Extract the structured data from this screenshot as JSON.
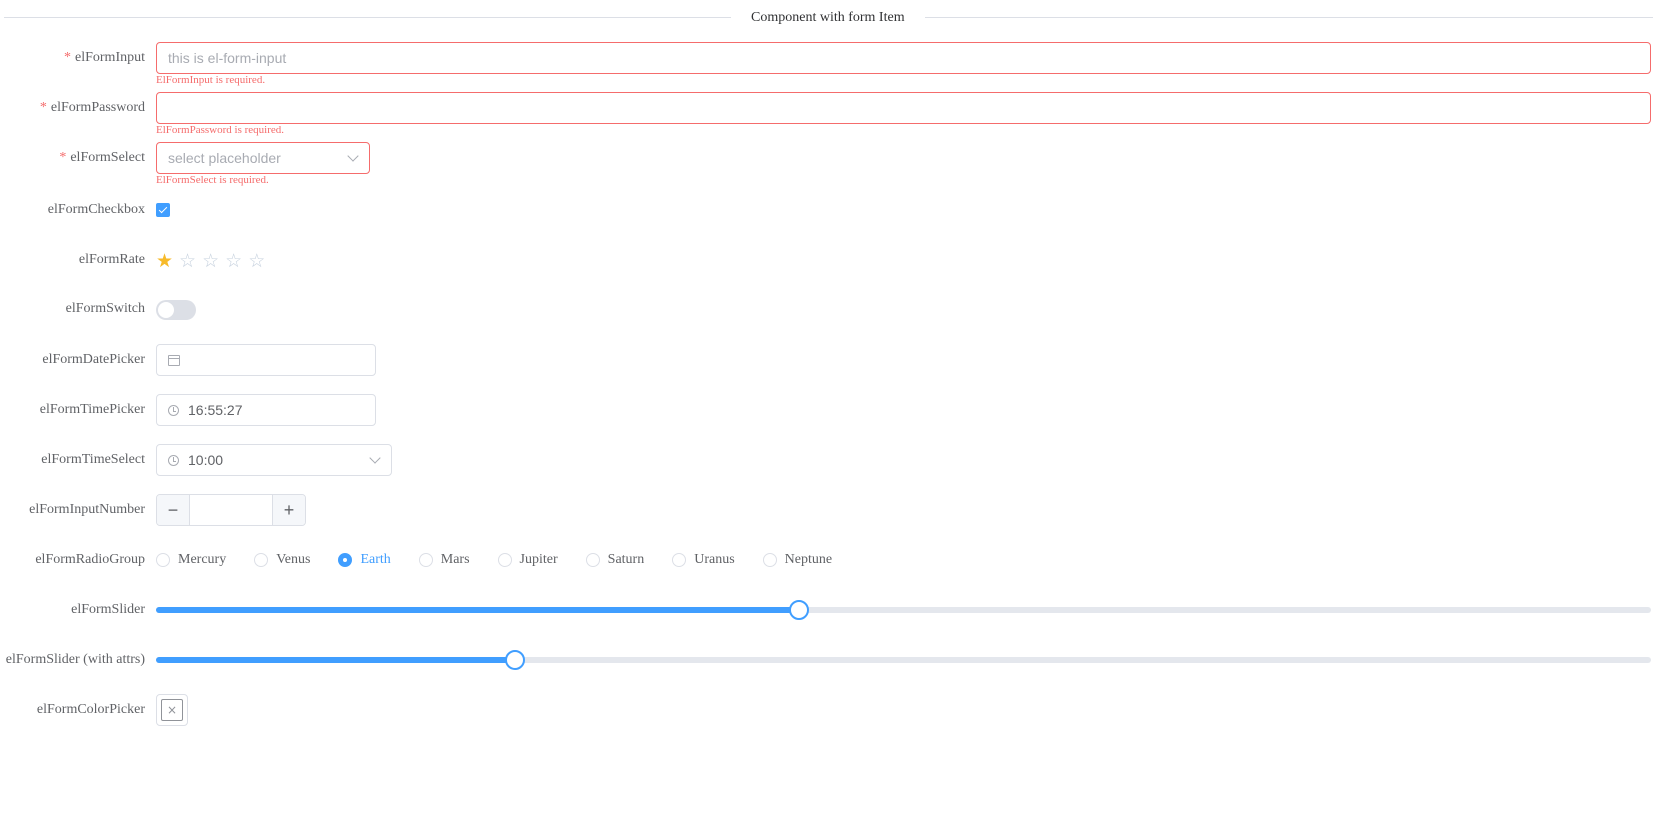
{
  "divider": {
    "text": "Component with form Item"
  },
  "fields": {
    "input": {
      "label": "elFormInput",
      "required": "*",
      "placeholder": "this is el-form-input",
      "error": "ElFormInput is required."
    },
    "password": {
      "label": "elFormPassword",
      "required": "*",
      "error": "ElFormPassword is required."
    },
    "select": {
      "label": "elFormSelect",
      "required": "*",
      "placeholder": "select placeholder",
      "error": "ElFormSelect is required."
    },
    "checkbox": {
      "label": "elFormCheckbox",
      "checked": true
    },
    "rate": {
      "label": "elFormRate",
      "value": 1,
      "max": 5,
      "active_color": "#f7ba2a"
    },
    "switch": {
      "label": "elFormSwitch",
      "on": false
    },
    "datepicker": {
      "label": "elFormDatePicker",
      "value": ""
    },
    "timepicker": {
      "label": "elFormTimePicker",
      "value": "16:55:27"
    },
    "timeselect": {
      "label": "elFormTimeSelect",
      "value": "10:00"
    },
    "inputnumber": {
      "label": "elFormInputNumber",
      "value": "",
      "minus": "−",
      "plus": "+"
    },
    "radiogroup": {
      "label": "elFormRadioGroup",
      "options": [
        "Mercury",
        "Venus",
        "Earth",
        "Mars",
        "Jupiter",
        "Saturn",
        "Uranus",
        "Neptune"
      ],
      "selected": "Earth"
    },
    "slider": {
      "label": "elFormSlider",
      "value_percent": 43
    },
    "slider_attrs": {
      "label": "elFormSlider (with attrs)",
      "value_percent": 24
    },
    "colorpicker": {
      "label": "elFormColorPicker",
      "empty_icon": "×"
    }
  },
  "colors": {
    "primary": "#409eff",
    "danger": "#f56c6c",
    "border": "#dcdfe6"
  }
}
